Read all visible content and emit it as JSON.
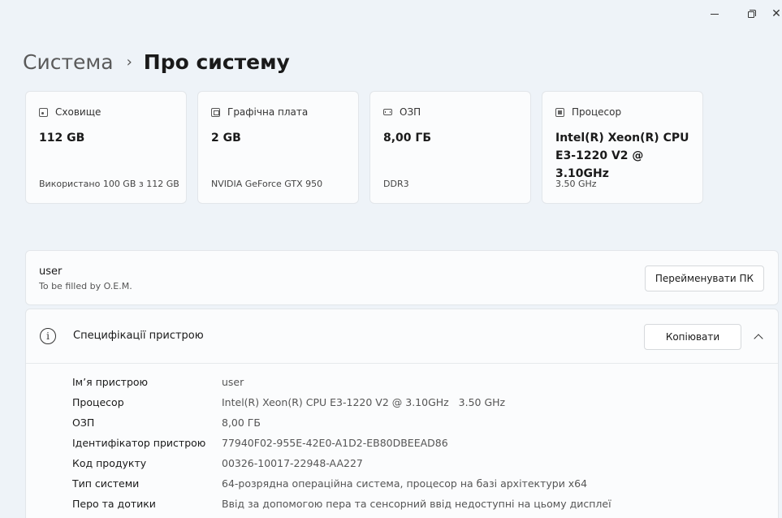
{
  "window": {
    "minimize": "minimize",
    "restore": "restore",
    "close": "✕"
  },
  "breadcrumb": {
    "parent": "Система",
    "separator": "›",
    "current": "Про систему"
  },
  "cards": [
    {
      "icon": "storage-icon",
      "title": "Сховище",
      "value": "112 GB",
      "sub": "Використано 100 GB з 112 GB"
    },
    {
      "icon": "graphics-card-icon",
      "title": "Графічна плата",
      "value": "2 GB",
      "sub": "NVIDIA GeForce GTX 950"
    },
    {
      "icon": "memory-icon",
      "title": "ОЗП",
      "value": "8,00 ГБ",
      "sub": "DDR3"
    },
    {
      "icon": "processor-icon",
      "title": "Процесор",
      "value": "Intel(R) Xeon(R) CPU E3-1220 V2 @ 3.10GHz",
      "sub": "3.50 GHz"
    }
  ],
  "device": {
    "name": "user",
    "model": "To be filled by O.E.M.",
    "rename_label": "Перейменувати ПК"
  },
  "specs": {
    "title": "Специфікації пристрою",
    "copy_label": "Копіювати",
    "rows": [
      {
        "label": "Ім’я пристрою",
        "value": "user"
      },
      {
        "label": "Процесор",
        "value": "Intel(R) Xeon(R) CPU E3-1220 V2 @ 3.10GHz   3.50 GHz"
      },
      {
        "label": "ОЗП",
        "value": "8,00 ГБ"
      },
      {
        "label": "Ідентифікатор пристрою",
        "value": "77940F02-955E-42E0-A1D2-EB80DBEEAD86"
      },
      {
        "label": "Код продукту",
        "value": "00326-10017-22948-AA227"
      },
      {
        "label": "Тип системи",
        "value": "64-розрядна операційна система, процесор на базі архітектури x64"
      },
      {
        "label": "Перо та дотики",
        "value": "Ввід за допомогою пера та сенсорний ввід недоступні на цьому дисплеї"
      }
    ]
  }
}
